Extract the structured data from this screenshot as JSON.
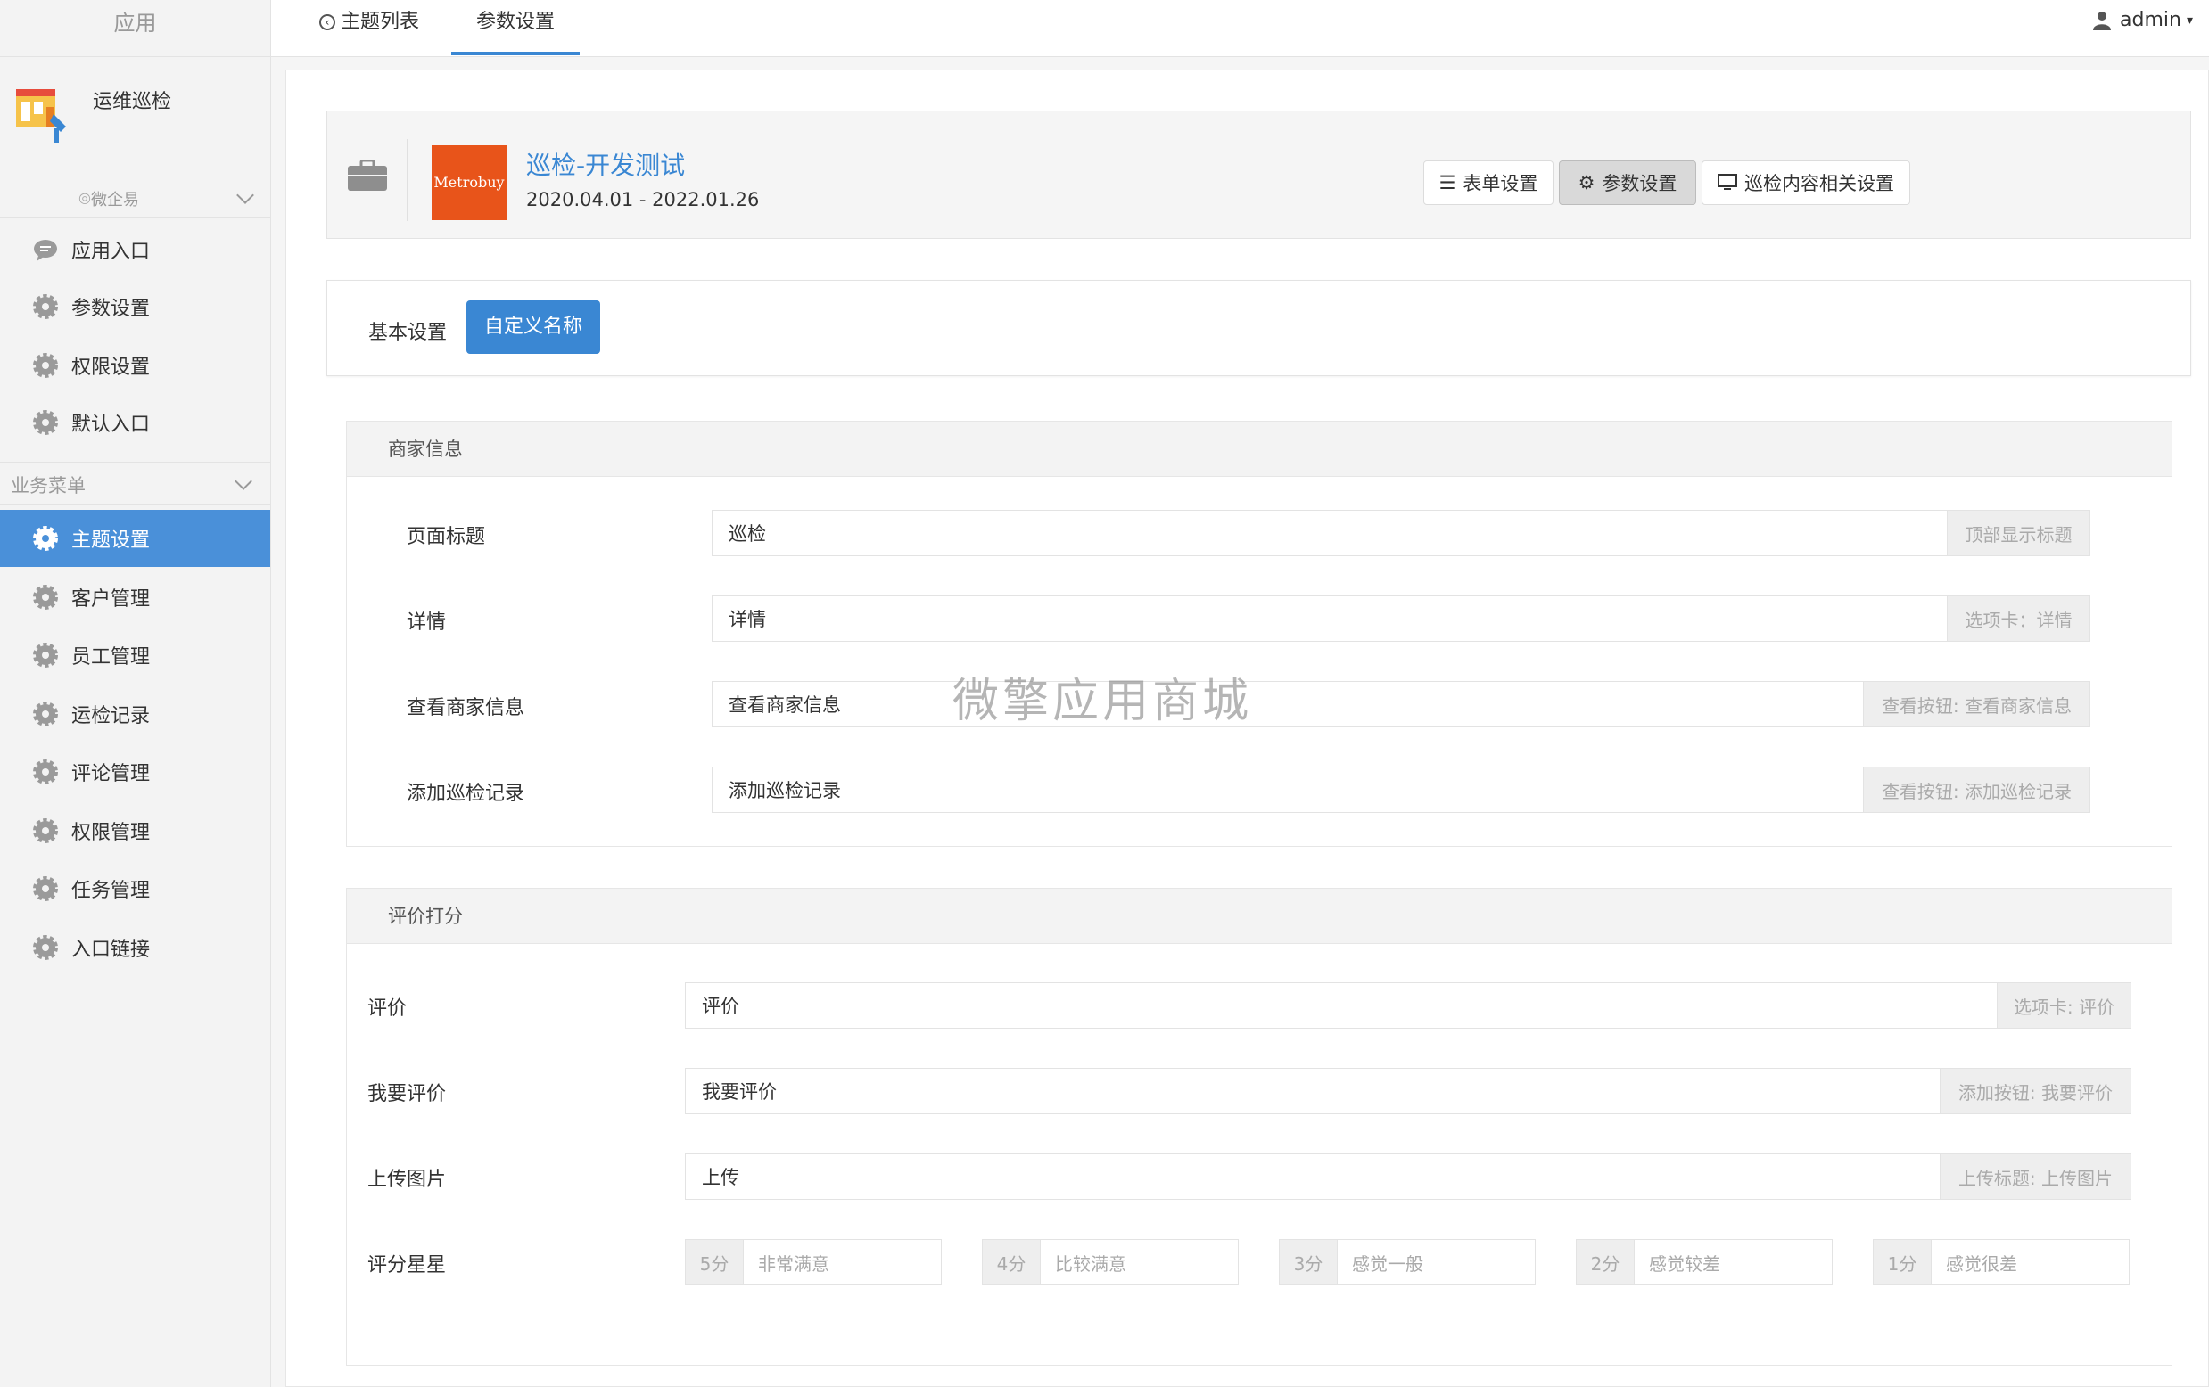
{
  "sidebar": {
    "header": "应用",
    "app_name": "运维巡检",
    "group_label": "微企易",
    "items_top": [
      {
        "label": "应用入口",
        "icon": "chat-icon"
      },
      {
        "label": "参数设置",
        "icon": "gear-icon"
      },
      {
        "label": "权限设置",
        "icon": "gear-icon"
      },
      {
        "label": "默认入口",
        "icon": "gear-icon"
      }
    ],
    "section_label": "业务菜单",
    "items_biz": [
      {
        "label": "主题设置",
        "active": true
      },
      {
        "label": "客户管理"
      },
      {
        "label": "员工管理"
      },
      {
        "label": "运检记录"
      },
      {
        "label": "评论管理"
      },
      {
        "label": "权限管理"
      },
      {
        "label": "任务管理"
      },
      {
        "label": "入口链接"
      }
    ]
  },
  "topbar": {
    "tab_list": "主题列表",
    "tab_params": "参数设置",
    "user": "admin"
  },
  "app_card": {
    "thumb_text": "Metrobuy",
    "title": "巡检-开发测试",
    "date_range": "2020.04.01 - 2022.01.26",
    "btn_form": "表单设置",
    "btn_params": "参数设置",
    "btn_content": "巡检内容相关设置"
  },
  "subtabs": {
    "basic": "基本设置",
    "custom": "自定义名称"
  },
  "merchant": {
    "header": "商家信息",
    "rows": [
      {
        "label": "页面标题",
        "value": "巡检",
        "addon": "顶部显示标题"
      },
      {
        "label": "详情",
        "value": "详情",
        "addon": "选项卡：详情"
      },
      {
        "label": "查看商家信息",
        "value": "查看商家信息",
        "addon": "查看按钮: 查看商家信息"
      },
      {
        "label": "添加巡检记录",
        "value": "添加巡检记录",
        "addon": "查看按钮: 添加巡检记录"
      }
    ]
  },
  "rating": {
    "header": "评价打分",
    "rows": [
      {
        "label": "评价",
        "value": "评价",
        "addon": "选项卡: 评价"
      },
      {
        "label": "我要评价",
        "value": "我要评价",
        "addon": "添加按钮: 我要评价"
      },
      {
        "label": "上传图片",
        "value": "上传",
        "addon": "上传标题: 上传图片"
      }
    ],
    "stars_label": "评分星星",
    "stars": [
      {
        "score": "5分",
        "text": "非常满意"
      },
      {
        "score": "4分",
        "text": "比较满意"
      },
      {
        "score": "3分",
        "text": "感觉一般"
      },
      {
        "score": "2分",
        "text": "感觉较差"
      },
      {
        "score": "1分",
        "text": "感觉很差"
      }
    ]
  },
  "watermark": "微擎应用商城",
  "colors": {
    "accent": "#3a87d3",
    "active_sidebar": "#4a90d9"
  }
}
